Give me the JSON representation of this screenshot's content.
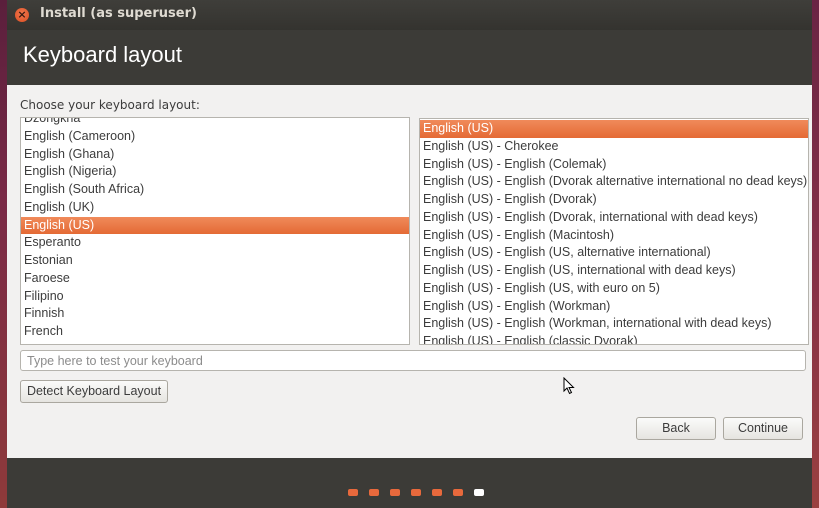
{
  "window": {
    "title": "Install (as superuser)"
  },
  "header": {
    "title": "Keyboard layout"
  },
  "prompt": "Choose your keyboard layout:",
  "layouts": {
    "items": [
      "Dzongkha",
      "English (Cameroon)",
      "English (Ghana)",
      "English (Nigeria)",
      "English (South Africa)",
      "English (UK)",
      "English (US)",
      "Esperanto",
      "Estonian",
      "Faroese",
      "Filipino",
      "Finnish",
      "French"
    ],
    "selected": "English (US)"
  },
  "variants": {
    "items": [
      "English (US)",
      "English (US) - Cherokee",
      "English (US) - English (Colemak)",
      "English (US) - English (Dvorak alternative international no dead keys)",
      "English (US) - English (Dvorak)",
      "English (US) - English (Dvorak, international with dead keys)",
      "English (US) - English (Macintosh)",
      "English (US) - English (US, alternative international)",
      "English (US) - English (US, international with dead keys)",
      "English (US) - English (US, with euro on 5)",
      "English (US) - English (Workman)",
      "English (US) - English (Workman, international with dead keys)",
      "English (US) - English (classic Dvorak)"
    ],
    "selected": "English (US)"
  },
  "test_input": {
    "placeholder": "Type here to test your keyboard",
    "value": ""
  },
  "buttons": {
    "detect": "Detect Keyboard Layout",
    "back": "Back",
    "continue": "Continue"
  },
  "progress": {
    "total_steps": 7,
    "current_step": 7
  },
  "colors": {
    "accent": "#e8693c",
    "window_bg": "#3c3b37",
    "content_bg": "#f2f1f0"
  },
  "icons": {
    "close": "close-icon",
    "cursor": "mouse-pointer-icon"
  }
}
